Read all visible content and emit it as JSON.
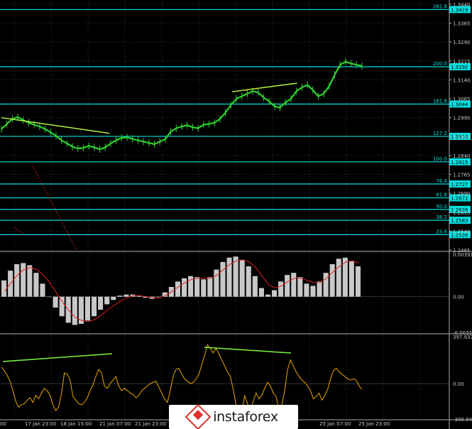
{
  "chart_data": [
    {
      "type": "line",
      "symbol_panel": "price",
      "ylim": [
        1.2465,
        1.344
      ],
      "y_ticks": [
        "1.3440",
        "1.3365",
        "1.3290",
        "1.3215",
        "1.3140",
        "1.3065",
        "1.2990",
        "1.2915",
        "1.2840",
        "1.2765",
        "1.2690",
        "1.2615",
        "1.2540",
        "1.2465"
      ],
      "fibonacci_levels": [
        {
          "pct": "261.8",
          "price": 1.3419,
          "label": "1.3419"
        },
        {
          "pct": "200.0",
          "price": 1.3192,
          "label": "1.3192"
        },
        {
          "pct": "161.8",
          "price": 1.3044,
          "label": "1.3044"
        },
        {
          "pct": "127.2",
          "price": 1.2916,
          "label": "1.2916"
        },
        {
          "pct": "100.0",
          "price": 1.2815,
          "label": "1.2815"
        },
        {
          "pct": "76.4",
          "price": 1.2727,
          "label": "1.2727"
        },
        {
          "pct": "61.8",
          "price": 1.2672,
          "label": "1.2672"
        },
        {
          "pct": "50.0",
          "price": 1.2626,
          "label": "1.2626"
        },
        {
          "pct": "38.2",
          "price": 1.2583,
          "label": "1.2583"
        },
        {
          "pct": "23.6",
          "price": 1.2526,
          "label": "1.2526"
        }
      ],
      "price_series": [
        1.2945,
        1.2965,
        1.2985,
        1.2992,
        1.298,
        1.297,
        1.2962,
        1.2955,
        1.2945,
        1.2932,
        1.2918,
        1.29,
        1.2888,
        1.2875,
        1.2868,
        1.287,
        1.2878,
        1.2872,
        1.2865,
        1.2872,
        1.2888,
        1.29,
        1.291,
        1.2912,
        1.2906,
        1.29,
        1.2895,
        1.289,
        1.2885,
        1.2895,
        1.2905,
        1.2935,
        1.2948,
        1.2955,
        1.296,
        1.2952,
        1.2948,
        1.2962,
        1.2965,
        1.297,
        1.2985,
        1.301,
        1.304,
        1.3065,
        1.3075,
        1.3085,
        1.3095,
        1.309,
        1.307,
        1.3055,
        1.3035,
        1.303,
        1.305,
        1.3065,
        1.3095,
        1.311,
        1.312,
        1.31,
        1.3075,
        1.3085,
        1.3115,
        1.316,
        1.32,
        1.3212,
        1.3205,
        1.32,
        1.3195
      ],
      "trend_lines": [
        {
          "from": [
            0.0,
            1.299
          ],
          "to": [
            0.3,
            1.2928
          ]
        },
        {
          "from": [
            0.64,
            1.3093
          ],
          "to": [
            0.82,
            1.3127
          ]
        }
      ]
    },
    {
      "type": "bar",
      "symbol_panel": "macd",
      "ylim": [
        -0.00329,
        0.00391
      ],
      "y_ticks": [
        "0.00391",
        "0.00",
        "-0.00329"
      ],
      "histogram": [
        0.0015,
        0.0024,
        0.003,
        0.0031,
        0.0029,
        0.0022,
        0.0012,
        0.0,
        -0.001,
        -0.0018,
        -0.0024,
        -0.0026,
        -0.0025,
        -0.0022,
        -0.0018,
        -0.0012,
        -0.0007,
        -0.0003,
        0.0001,
        0.0002,
        0.0002,
        0.0001,
        -0.0001,
        -0.0002,
        0.0,
        0.0004,
        0.0009,
        0.0014,
        0.0017,
        0.0019,
        0.0018,
        0.0016,
        0.0018,
        0.0025,
        0.0032,
        0.0036,
        0.0037,
        0.0034,
        0.0028,
        0.0019,
        0.0008,
        0.0002,
        0.0006,
        0.0014,
        0.002,
        0.0022,
        0.0018,
        0.0012,
        0.001,
        0.0014,
        0.0022,
        0.003,
        0.0035,
        0.0036,
        0.0033,
        0.0028
      ],
      "signal": [
        0.0005,
        0.0013,
        0.002,
        0.0025,
        0.0027,
        0.0025,
        0.002,
        0.0013,
        0.0004,
        -0.0005,
        -0.0013,
        -0.0019,
        -0.0022,
        -0.0023,
        -0.0021,
        -0.0017,
        -0.0012,
        -0.0008,
        -0.0004,
        -0.0001,
        0.0001,
        0.0001,
        0.0,
        -0.0001,
        -0.0001,
        0.0001,
        0.0005,
        0.0009,
        0.0013,
        0.0016,
        0.0017,
        0.0017,
        0.0017,
        0.002,
        0.0025,
        0.003,
        0.0033,
        0.0034,
        0.0032,
        0.0027,
        0.0019,
        0.0011,
        0.0008,
        0.001,
        0.0014,
        0.0017,
        0.0017,
        0.0015,
        0.0013,
        0.0013,
        0.0017,
        0.0023,
        0.0028,
        0.0032,
        0.0033,
        0.0031
      ]
    },
    {
      "type": "line",
      "symbol_panel": "cci",
      "ylim": [
        -300.942,
        397.9371
      ],
      "y_ticks": [
        "397.9371",
        "0.00",
        "-300.942"
      ],
      "values": [
        140,
        110,
        70,
        20,
        -60,
        -150,
        -200,
        -180,
        -170,
        -140,
        -120,
        -160,
        -100,
        -130,
        -80,
        -40,
        -60,
        -100,
        -180,
        -230,
        -200,
        -80,
        90,
        80,
        30,
        -110,
        -140,
        -170,
        -180,
        -160,
        -120,
        -60,
        -10,
        60,
        120,
        90,
        -20,
        -40,
        0,
        30,
        60,
        -20,
        -60,
        -40,
        -60,
        -80,
        -90,
        -120,
        -100,
        -60,
        -40,
        -20,
        0,
        10,
        20,
        -30,
        -80,
        -130,
        -160,
        -60,
        60,
        120,
        130,
        80,
        40,
        20,
        0,
        10,
        40,
        80,
        160,
        240,
        330,
        300,
        260,
        300,
        250,
        200,
        150,
        100,
        60,
        -50,
        -180,
        -300,
        -240,
        -100,
        -170,
        -220,
        -150,
        -80,
        -130,
        -100,
        -40,
        10,
        -20,
        -80,
        -110,
        -220,
        -180,
        -60,
        120,
        200,
        150,
        100,
        60,
        30,
        10,
        -20,
        -60,
        -130,
        -110,
        -80,
        -140,
        -100,
        -50,
        40,
        110,
        130,
        100,
        80,
        60,
        40,
        30,
        40,
        30,
        -20,
        -50
      ]
    }
  ],
  "price_panel": {
    "price_labels": [
      "1.3440",
      "1.3365",
      "1.3290",
      "1.3215",
      "1.3140",
      "1.3065",
      "1.2990",
      "1.2915",
      "1.2840",
      "1.2765",
      "1.2690",
      "1.2615",
      "1.2540",
      "1.2465"
    ]
  },
  "macd_panel": {
    "labels": [
      "0.00391",
      "0.00",
      "-0.00329"
    ]
  },
  "cci_panel": {
    "labels": [
      "397.9371",
      "0.00",
      "-300.942"
    ]
  },
  "time_axis": {
    "labels": [
      "00",
      "17 Jan 23:00",
      "18 Jan 15:00",
      "21 Jan 07:00",
      "21 Jan 23:00",
      "22 Jan",
      "25 Jan 07:00",
      "25 Jan 23:00"
    ]
  },
  "watermark": {
    "brand": "instaforex"
  },
  "colors": {
    "background": "#000000",
    "price": "#2fd12f",
    "fibo": "#00e0e0",
    "trendline": "#b6f542",
    "macd_hist": "#c8c8c8",
    "macd_signal": "#e02020",
    "cci": "#e6a800",
    "cci_divergence": "#7cf542",
    "red_dotted": "#c02020"
  }
}
